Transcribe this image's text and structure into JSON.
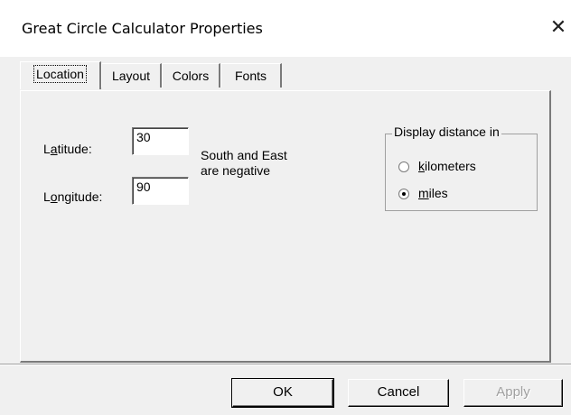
{
  "window": {
    "title": "Great Circle Calculator Properties",
    "close_glyph": "✕"
  },
  "tabs": [
    {
      "label": "Location",
      "selected": true
    },
    {
      "label": "Layout",
      "selected": false
    },
    {
      "label": "Colors",
      "selected": false
    },
    {
      "label": "Fonts",
      "selected": false
    }
  ],
  "location": {
    "latitude_label_pre": "L",
    "latitude_label_mnemonic": "a",
    "latitude_label_post": "titude:",
    "latitude_value": "30",
    "longitude_label_pre": "L",
    "longitude_label_mnemonic": "o",
    "longitude_label_post": "ngitude:",
    "longitude_value": "90",
    "note_line1": "South and East",
    "note_line2": "are negative"
  },
  "display_distance": {
    "legend": "Display distance in",
    "options": [
      {
        "mnemonic": "k",
        "rest": "ilometers",
        "selected": false
      },
      {
        "mnemonic": "m",
        "rest": "iles",
        "selected": true
      }
    ]
  },
  "buttons": {
    "ok": "OK",
    "cancel": "Cancel",
    "apply": "Apply"
  }
}
